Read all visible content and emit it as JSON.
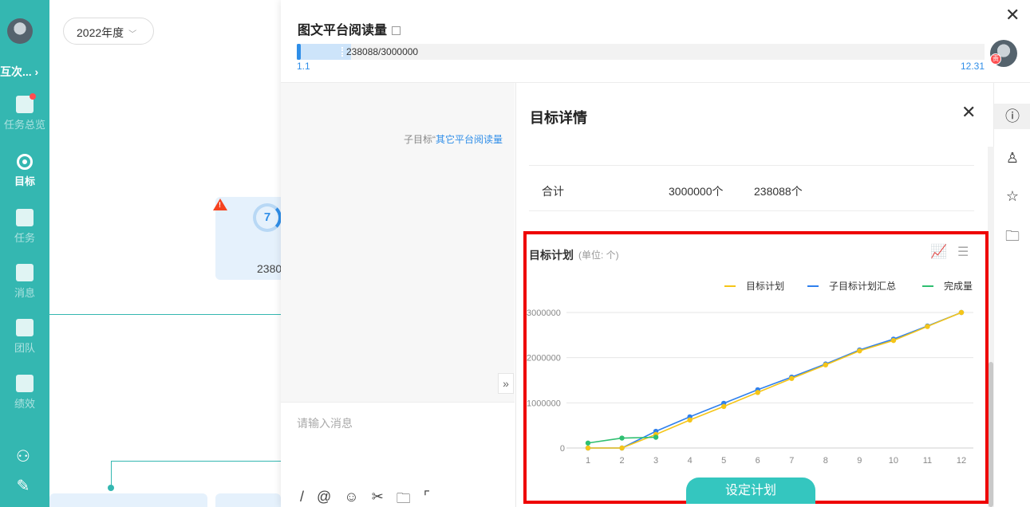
{
  "sidebar": {
    "user_name": "互次... ›",
    "items": [
      {
        "label": "任务总览",
        "icon": "chart-icon",
        "badge": true
      },
      {
        "label": "目标",
        "icon": "target-icon",
        "active": true
      },
      {
        "label": "任务",
        "icon": "task-list-icon"
      },
      {
        "label": "消息",
        "icon": "message-icon"
      },
      {
        "label": "团队",
        "icon": "team-icon"
      },
      {
        "label": "绩效",
        "icon": "performance-icon"
      }
    ]
  },
  "canvas": {
    "year_select": "2022年度",
    "card_ring": "7",
    "card_value": "2380"
  },
  "panel": {
    "title": "图文平台阅读量",
    "progress_text": "238088/3000000",
    "progress_fraction": 0.0794,
    "range_start": "1.1",
    "range_end": "12.31",
    "avatar_badge": "责"
  },
  "chat": {
    "sub_goal_prefix": "子目标“",
    "sub_goal_link": "其它平台阅读量",
    "placeholder": "请输入消息",
    "expand": "»"
  },
  "detail": {
    "title": "目标详情",
    "total_label": "合计",
    "total_target": "3000000个",
    "total_done": "238088个",
    "chart_title": "目标计划",
    "chart_unit": "(单位: 个)",
    "set_plan_button": "设定计划"
  },
  "chart_data": {
    "type": "line",
    "title": "目标计划",
    "subtitle": "(单位: 个)",
    "x": [
      1,
      2,
      3,
      4,
      5,
      6,
      7,
      8,
      9,
      10,
      11,
      12
    ],
    "ylim": [
      0,
      3000000
    ],
    "yticks": [
      0,
      1000000,
      2000000,
      3000000
    ],
    "legend_position": "top-right",
    "grid": true,
    "series": [
      {
        "name": "目标计划",
        "color": "#f5c518",
        "values": [
          0,
          0,
          300000,
          620000,
          920000,
          1230000,
          1540000,
          1840000,
          2150000,
          2380000,
          2690000,
          3000000
        ]
      },
      {
        "name": "子目标计划汇总",
        "color": "#2f80ed",
        "values": [
          0,
          0,
          370000,
          690000,
          990000,
          1290000,
          1570000,
          1860000,
          2170000,
          2410000,
          2700000,
          3000000
        ]
      },
      {
        "name": "完成量",
        "color": "#2fbf71",
        "values": [
          110000,
          220000,
          238088
        ]
      }
    ]
  },
  "colors": {
    "sidebar": "#34b7b1",
    "accent_blue": "#2f8ee8",
    "highlight_border": "#ee0000",
    "button": "#34c6bf"
  }
}
